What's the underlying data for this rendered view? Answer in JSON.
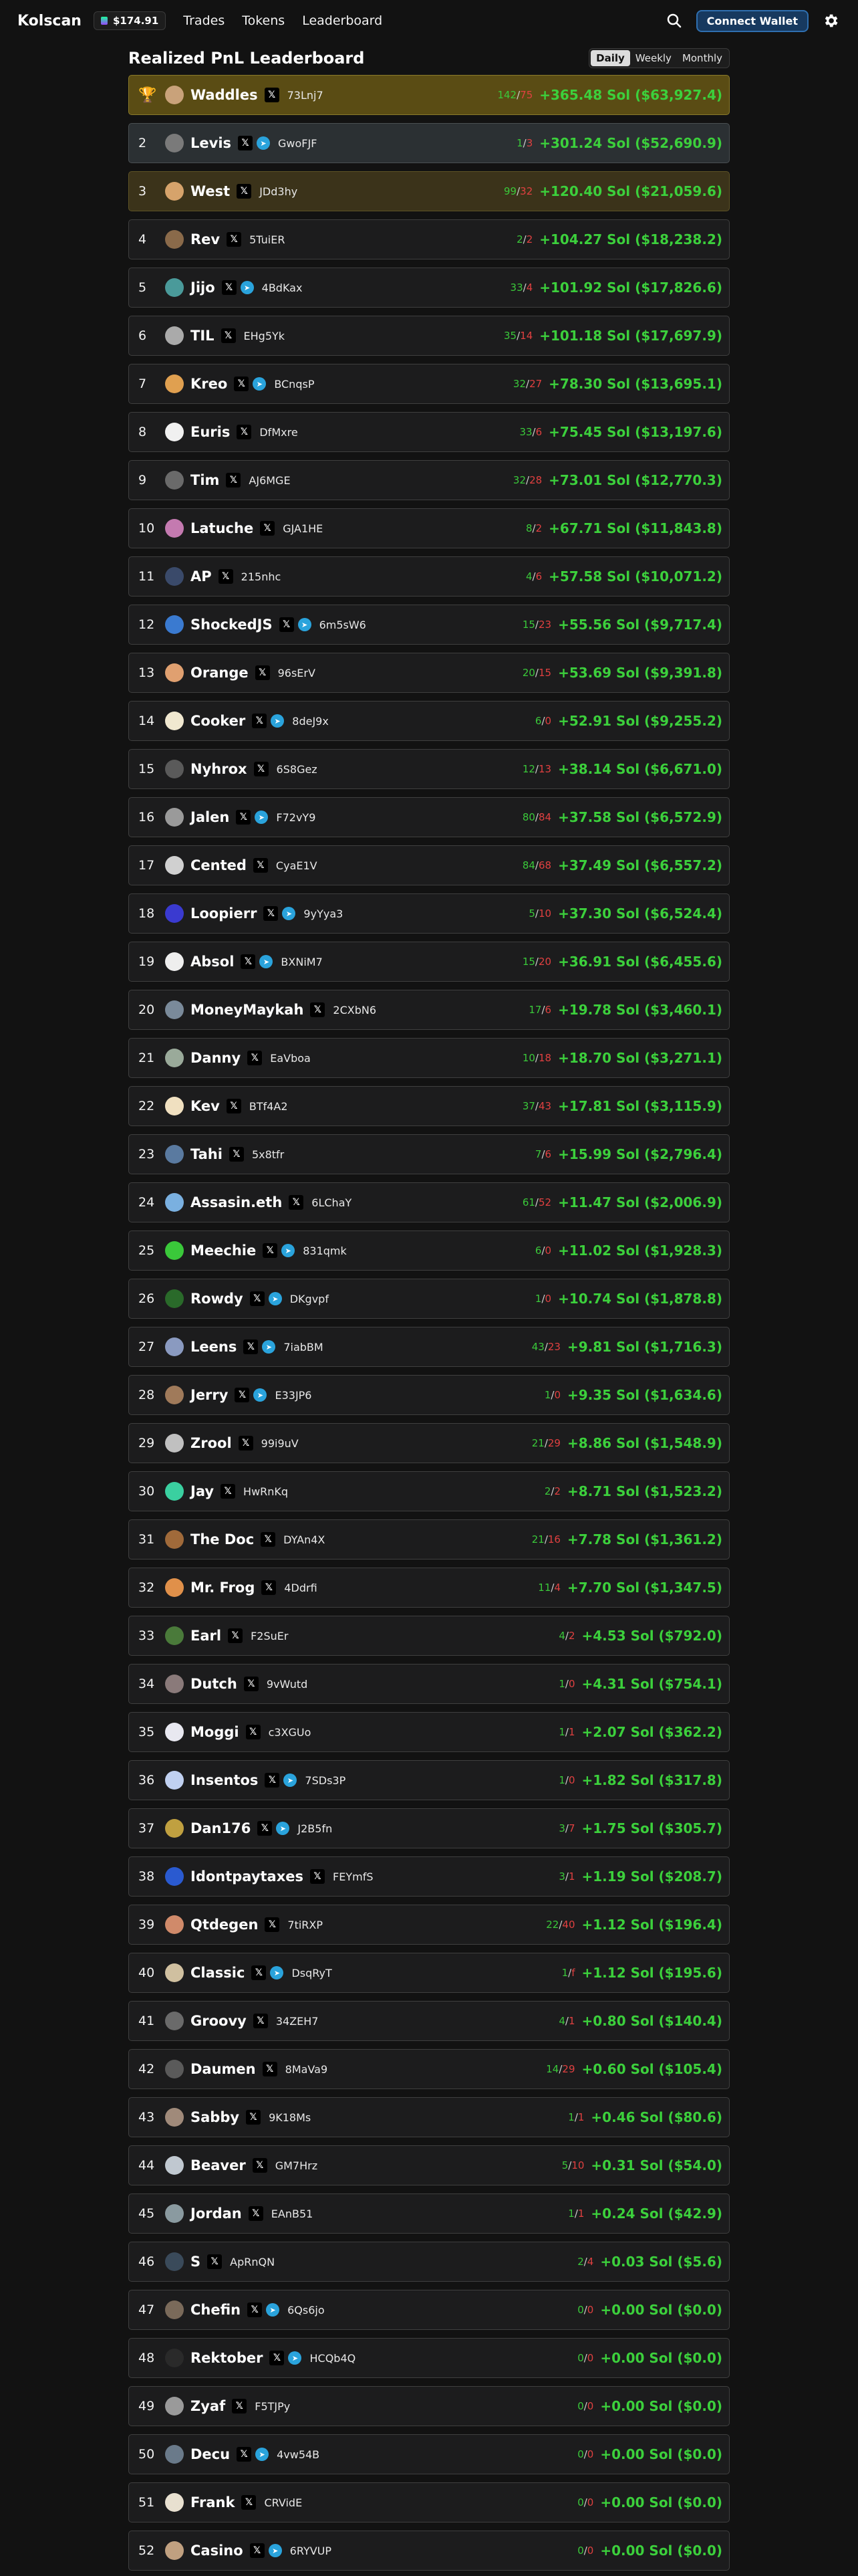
{
  "header": {
    "logo": "Kolscan",
    "sol_price": "$174.91",
    "nav": [
      "Trades",
      "Tokens",
      "Leaderboard"
    ],
    "connect_label": "Connect Wallet"
  },
  "board": {
    "title": "Realized PnL Leaderboard",
    "tabs": [
      "Daily",
      "Weekly",
      "Monthly"
    ],
    "active_tab": "Daily"
  },
  "rows": [
    {
      "rank": "",
      "trophy": "🏆",
      "name": "Waddles",
      "tg": false,
      "addr": "73Lnj7",
      "w": "142",
      "l": "75",
      "pnl": "+365.48 Sol ($63,927.4)",
      "avatar": "#c9a27a"
    },
    {
      "rank": "2",
      "name": "Levis",
      "tg": true,
      "addr": "GwoFJF",
      "w": "1",
      "l": "3",
      "pnl": "+301.24 Sol ($52,690.9)",
      "avatar": "#7a7a7a"
    },
    {
      "rank": "3",
      "name": "West",
      "tg": false,
      "addr": "JDd3hy",
      "w": "99",
      "l": "32",
      "pnl": "+120.40 Sol ($21,059.6)",
      "avatar": "#d6a36b"
    },
    {
      "rank": "4",
      "name": "Rev",
      "tg": false,
      "addr": "5TuiER",
      "w": "2",
      "l": "2",
      "pnl": "+104.27 Sol ($18,238.2)",
      "avatar": "#8a6a4a"
    },
    {
      "rank": "5",
      "name": "Jijo",
      "tg": true,
      "addr": "4BdKax",
      "w": "33",
      "l": "4",
      "pnl": "+101.92 Sol ($17,826.6)",
      "avatar": "#4a9a9a"
    },
    {
      "rank": "6",
      "name": "TIL",
      "tg": false,
      "addr": "EHg5Yk",
      "w": "35",
      "l": "14",
      "pnl": "+101.18 Sol ($17,697.9)",
      "avatar": "#aaaaaa"
    },
    {
      "rank": "7",
      "name": "Kreo",
      "tg": true,
      "addr": "BCnqsP",
      "w": "32",
      "l": "27",
      "pnl": "+78.30 Sol ($13,695.1)",
      "avatar": "#e0a050"
    },
    {
      "rank": "8",
      "name": "Euris",
      "tg": false,
      "addr": "DfMxre",
      "w": "33",
      "l": "6",
      "pnl": "+75.45 Sol ($13,197.6)",
      "avatar": "#f0f0f0"
    },
    {
      "rank": "9",
      "name": "Tim",
      "tg": false,
      "addr": "AJ6MGE",
      "w": "32",
      "l": "28",
      "pnl": "+73.01 Sol ($12,770.3)",
      "avatar": "#6a6a6a"
    },
    {
      "rank": "10",
      "name": "Latuche",
      "tg": false,
      "addr": "GJA1HE",
      "w": "8",
      "l": "2",
      "pnl": "+67.71 Sol ($11,843.8)",
      "avatar": "#c47ab0"
    },
    {
      "rank": "11",
      "name": "AP",
      "tg": false,
      "addr": "215nhc",
      "w": "4",
      "l": "6",
      "pnl": "+57.58 Sol ($10,071.2)",
      "avatar": "#3a4a6a"
    },
    {
      "rank": "12",
      "name": "ShockedJS",
      "tg": true,
      "addr": "6m5sW6",
      "w": "15",
      "l": "23",
      "pnl": "+55.56 Sol ($9,717.4)",
      "avatar": "#3a7ad0"
    },
    {
      "rank": "13",
      "name": "Orange",
      "tg": false,
      "addr": "96sErV",
      "w": "20",
      "l": "15",
      "pnl": "+53.69 Sol ($9,391.8)",
      "avatar": "#e0a070"
    },
    {
      "rank": "14",
      "name": "Cooker",
      "tg": true,
      "addr": "8deJ9x",
      "w": "6",
      "l": "0",
      "pnl": "+52.91 Sol ($9,255.2)",
      "avatar": "#f0e8d0"
    },
    {
      "rank": "15",
      "name": "Nyhrox",
      "tg": false,
      "addr": "6S8Gez",
      "w": "12",
      "l": "13",
      "pnl": "+38.14 Sol ($6,671.0)",
      "avatar": "#5a5a5a"
    },
    {
      "rank": "16",
      "name": "Jalen",
      "tg": true,
      "addr": "F72vY9",
      "w": "80",
      "l": "84",
      "pnl": "+37.58 Sol ($6,572.9)",
      "avatar": "#9a9a9a"
    },
    {
      "rank": "17",
      "name": "Cented",
      "tg": false,
      "addr": "CyaE1V",
      "w": "84",
      "l": "68",
      "pnl": "+37.49 Sol ($6,557.2)",
      "avatar": "#d0d0d0"
    },
    {
      "rank": "18",
      "name": "Loopierr",
      "tg": true,
      "addr": "9yYya3",
      "w": "5",
      "l": "10",
      "pnl": "+37.30 Sol ($6,524.4)",
      "avatar": "#3a3ad0"
    },
    {
      "rank": "19",
      "name": "Absol",
      "tg": true,
      "addr": "BXNiM7",
      "w": "15",
      "l": "20",
      "pnl": "+36.91 Sol ($6,455.6)",
      "avatar": "#eeeeee"
    },
    {
      "rank": "20",
      "name": "MoneyMaykah",
      "tg": false,
      "addr": "2CXbN6",
      "w": "17",
      "l": "6",
      "pnl": "+19.78 Sol ($3,460.1)",
      "avatar": "#7a8a9a"
    },
    {
      "rank": "21",
      "name": "Danny",
      "tg": false,
      "addr": "EaVboa",
      "w": "10",
      "l": "18",
      "pnl": "+18.70 Sol ($3,271.1)",
      "avatar": "#9aaa9a"
    },
    {
      "rank": "22",
      "name": "Kev",
      "tg": false,
      "addr": "BTf4A2",
      "w": "37",
      "l": "43",
      "pnl": "+17.81 Sol ($3,115.9)",
      "avatar": "#f0e0c0"
    },
    {
      "rank": "23",
      "name": "Tahi",
      "tg": false,
      "addr": "5x8tfr",
      "w": "7",
      "l": "6",
      "pnl": "+15.99 Sol ($2,796.4)",
      "avatar": "#5a7aa0"
    },
    {
      "rank": "24",
      "name": "Assasin.eth",
      "tg": false,
      "addr": "6LChaY",
      "w": "61",
      "l": "52",
      "pnl": "+11.47 Sol ($2,006.9)",
      "avatar": "#7ab0e0"
    },
    {
      "rank": "25",
      "name": "Meechie",
      "tg": true,
      "addr": "831qmk",
      "w": "6",
      "l": "0",
      "pnl": "+11.02 Sol ($1,928.3)",
      "avatar": "#3ac83a"
    },
    {
      "rank": "26",
      "name": "Rowdy",
      "tg": true,
      "addr": "DKgvpf",
      "w": "1",
      "l": "0",
      "pnl": "+10.74 Sol ($1,878.8)",
      "avatar": "#2a6a2a"
    },
    {
      "rank": "27",
      "name": "Leens",
      "tg": true,
      "addr": "7iabBM",
      "w": "43",
      "l": "23",
      "pnl": "+9.81 Sol ($1,716.3)",
      "avatar": "#8a9ac0"
    },
    {
      "rank": "28",
      "name": "Jerry",
      "tg": true,
      "addr": "E33JP6",
      "w": "1",
      "l": "0",
      "pnl": "+9.35 Sol ($1,634.6)",
      "avatar": "#a07a5a"
    },
    {
      "rank": "29",
      "name": "Zrool",
      "tg": false,
      "addr": "99i9uV",
      "w": "21",
      "l": "29",
      "pnl": "+8.86 Sol ($1,548.9)",
      "avatar": "#c0c0c0"
    },
    {
      "rank": "30",
      "name": "Jay",
      "tg": false,
      "addr": "HwRnKq",
      "w": "2",
      "l": "2",
      "pnl": "+8.71 Sol ($1,523.2)",
      "avatar": "#3ad0a0"
    },
    {
      "rank": "31",
      "name": "The Doc",
      "tg": false,
      "addr": "DYAn4X",
      "w": "21",
      "l": "16",
      "pnl": "+7.78 Sol ($1,361.2)",
      "avatar": "#a06a3a"
    },
    {
      "rank": "32",
      "name": "Mr. Frog",
      "tg": false,
      "addr": "4Ddrfi",
      "w": "11",
      "l": "4",
      "pnl": "+7.70 Sol ($1,347.5)",
      "avatar": "#e0904a"
    },
    {
      "rank": "33",
      "name": "Earl",
      "tg": false,
      "addr": "F2SuEr",
      "w": "4",
      "l": "2",
      "pnl": "+4.53 Sol ($792.0)",
      "avatar": "#4a7a3a"
    },
    {
      "rank": "34",
      "name": "Dutch",
      "tg": false,
      "addr": "9vWutd",
      "w": "1",
      "l": "0",
      "pnl": "+4.31 Sol ($754.1)",
      "avatar": "#8a7a7a"
    },
    {
      "rank": "35",
      "name": "Moggi",
      "tg": false,
      "addr": "c3XGUo",
      "w": "1",
      "l": "1",
      "pnl": "+2.07 Sol ($362.2)",
      "avatar": "#e8e8f0"
    },
    {
      "rank": "36",
      "name": "Insentos",
      "tg": true,
      "addr": "7SDs3P",
      "w": "1",
      "l": "0",
      "pnl": "+1.82 Sol ($317.8)",
      "avatar": "#c0d0f0"
    },
    {
      "rank": "37",
      "name": "Dan176",
      "tg": true,
      "addr": "J2B5fn",
      "w": "3",
      "l": "7",
      "pnl": "+1.75 Sol ($305.7)",
      "avatar": "#c0a040"
    },
    {
      "rank": "38",
      "name": "Idontpaytaxes",
      "tg": false,
      "addr": "FEYmfS",
      "w": "3",
      "l": "1",
      "pnl": "+1.19 Sol ($208.7)",
      "avatar": "#2a5ad0"
    },
    {
      "rank": "39",
      "name": "Qtdegen",
      "tg": false,
      "addr": "7tiRXP",
      "w": "22",
      "l": "40",
      "pnl": "+1.12 Sol ($196.4)",
      "avatar": "#d08a6a"
    },
    {
      "rank": "40",
      "name": "Classic",
      "tg": true,
      "addr": "DsqRyT",
      "w": "1",
      "l": "f",
      "pnl": "+1.12 Sol ($195.6)",
      "avatar": "#d0c0a0"
    },
    {
      "rank": "41",
      "name": "Groovy",
      "tg": false,
      "addr": "34ZEH7",
      "w": "4",
      "l": "1",
      "pnl": "+0.80 Sol ($140.4)",
      "avatar": "#6a6a6a"
    },
    {
      "rank": "42",
      "name": "Daumen",
      "tg": false,
      "addr": "8MaVa9",
      "w": "14",
      "l": "29",
      "pnl": "+0.60 Sol ($105.4)",
      "avatar": "#5a5a5a"
    },
    {
      "rank": "43",
      "name": "Sabby",
      "tg": false,
      "addr": "9K18Ms",
      "w": "1",
      "l": "1",
      "pnl": "+0.46 Sol ($80.6)",
      "avatar": "#a08a7a"
    },
    {
      "rank": "44",
      "name": "Beaver",
      "tg": false,
      "addr": "GM7Hrz",
      "w": "5",
      "l": "10",
      "pnl": "+0.31 Sol ($54.0)",
      "avatar": "#c0c8d0"
    },
    {
      "rank": "45",
      "name": "Jordan",
      "tg": false,
      "addr": "EAnB51",
      "w": "1",
      "l": "1",
      "pnl": "+0.24 Sol ($42.9)",
      "avatar": "#8a9aa0"
    },
    {
      "rank": "46",
      "name": "S",
      "tg": false,
      "addr": "ApRnQN",
      "w": "2",
      "l": "4",
      "pnl": "+0.03 Sol ($5.6)",
      "avatar": "#3a4a5a"
    },
    {
      "rank": "47",
      "name": "Chefin",
      "tg": true,
      "addr": "6Qs6jo",
      "w": "0",
      "l": "0",
      "pnl": "+0.00 Sol ($0.0)",
      "avatar": "#7a6a5a"
    },
    {
      "rank": "48",
      "name": "Rektober",
      "tg": true,
      "addr": "HCQb4Q",
      "w": "0",
      "l": "0",
      "pnl": "+0.00 Sol ($0.0)",
      "avatar": "#2a2a2a"
    },
    {
      "rank": "49",
      "name": "Zyaf",
      "tg": false,
      "addr": "F5TJPy",
      "w": "0",
      "l": "0",
      "pnl": "+0.00 Sol ($0.0)",
      "avatar": "#9a9a9a"
    },
    {
      "rank": "50",
      "name": "Decu",
      "tg": true,
      "addr": "4vw54B",
      "w": "0",
      "l": "0",
      "pnl": "+0.00 Sol ($0.0)",
      "avatar": "#6a7a8a"
    },
    {
      "rank": "51",
      "name": "Frank",
      "tg": false,
      "addr": "CRVidE",
      "w": "0",
      "l": "0",
      "pnl": "+0.00 Sol ($0.0)",
      "avatar": "#e8e0d0"
    },
    {
      "rank": "52",
      "name": "Casino",
      "tg": true,
      "addr": "6RYVUP",
      "w": "0",
      "l": "0",
      "pnl": "+0.00 Sol ($0.0)",
      "avatar": "#c0a080"
    }
  ]
}
